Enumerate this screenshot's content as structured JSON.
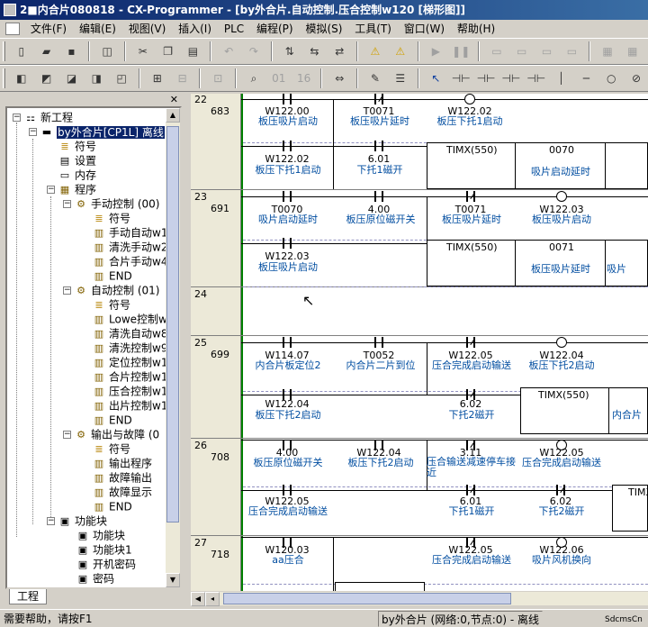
{
  "window": {
    "title": "2■内合片080818 - CX-Programmer - [by外合片.自动控制.压合控制w120 [梯形图]]"
  },
  "menu": [
    "文件(F)",
    "编辑(E)",
    "视图(V)",
    "插入(I)",
    "PLC",
    "编程(P)",
    "模拟(S)",
    "工具(T)",
    "窗口(W)",
    "帮助(H)"
  ],
  "toolbar": {
    "counter_label": "16"
  },
  "tree": {
    "root": "新工程",
    "plc": "by外合片[CP1L] 离线",
    "symbols": "符号",
    "settings": "设置",
    "memory": "内存",
    "program": "程序",
    "manual": "手动控制  (00)",
    "manual_items": [
      "符号",
      "手动自动w1",
      "清洗手动w2",
      "合片手动w4",
      "END"
    ],
    "auto": "自动控制  (01)",
    "auto_items": [
      "符号",
      "Lowe控制w7",
      "清洗自动w8",
      "清洗控制w9",
      "定位控制w1",
      "合片控制w1",
      "压合控制w1",
      "出片控制w1",
      "END"
    ],
    "io": "输出与故障  (0",
    "io_items": [
      "符号",
      "输出程序",
      "故障输出",
      "故障显示",
      "END"
    ],
    "fb": "功能块",
    "fb_items": [
      "功能块",
      "功能块1",
      "开机密码",
      "密码"
    ],
    "tab": "工程"
  },
  "ladder": {
    "rungs": [
      {
        "num": "22",
        "step": "683"
      },
      {
        "num": "23",
        "step": "691"
      },
      {
        "num": "24",
        "step": ""
      },
      {
        "num": "25",
        "step": "699"
      },
      {
        "num": "26",
        "step": "708"
      },
      {
        "num": "27",
        "step": "718"
      }
    ],
    "r22": {
      "a1": "W122.00",
      "c1": "板压吸片启动",
      "a2": "T0071",
      "c2": "板压吸片延时",
      "a3": "W122.02",
      "c3": "板压下托1启动",
      "a4": "W122.02",
      "c4": "板压下托1启动",
      "a5": "6.01",
      "c5": "下托1磁开",
      "timx": "TIMX(550)",
      "t_no": "0070",
      "t_c": "吸片启动延时"
    },
    "r23": {
      "a1": "T0070",
      "c1": "吸片启动延时",
      "a2": "4.00",
      "c2": "板压原位磁开关",
      "a3": "T0071",
      "c3": "板压吸片延时",
      "a4": "W122.03",
      "c4": "板压吸片启动",
      "a5": "W122.03",
      "c5": "板压吸片启动",
      "timx": "TIMX(550)",
      "t_no": "0071",
      "t_c": "板压吸片延时",
      "t_c2": "吸片"
    },
    "r25": {
      "a1": "W114.07",
      "c1": "内合片板定位2",
      "a2": "T0052",
      "c2": "内合片二片到位",
      "a3": "W122.05",
      "c3": "压合完成启动输送",
      "a4": "W122.04",
      "c4": "板压下托2启动",
      "a5": "W122.04",
      "c5": "板压下托2启动",
      "a6": "6.02",
      "c6": "下托2磁开",
      "timx": "TIMX(550)",
      "t_c": "内合片"
    },
    "r26": {
      "a1": "4.00",
      "c1": "板压原位磁开关",
      "a2": "W122.04",
      "c2": "板压下托2启动",
      "a3": "3.11",
      "c3": "压合输送减速停车接近",
      "a4": "W122.05",
      "c4": "压合完成启动输送",
      "a5": "W122.05",
      "c5": "压合完成启动输送",
      "a6": "6.01",
      "c6": "下托1磁开",
      "a7": "6.02",
      "c7": "下托2磁开",
      "timx": "TIMX"
    },
    "r27": {
      "a1": "W120.03",
      "c1": "aa压合",
      "a2": "W122.05",
      "c2": "压合完成启动输送",
      "a3": "W122.06",
      "c3": "吸片风机换向"
    }
  },
  "status": {
    "help": "需要帮助，请按F1",
    "plc": "by外合片 (网络:0,节点:0) - 离线",
    "right": "SdcmsCn"
  }
}
